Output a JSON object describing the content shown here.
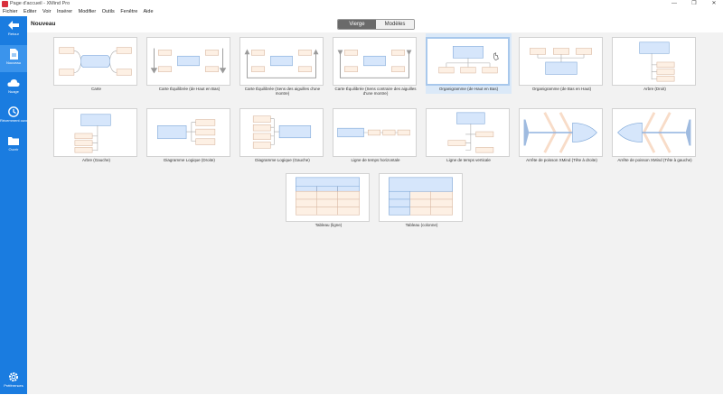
{
  "window": {
    "title": "Page d'accueil - XMind Pro",
    "min": "—",
    "max": "❐",
    "close": "✕"
  },
  "menu": [
    "Fichier",
    "Editer",
    "Voir",
    "Insérer",
    "Modifier",
    "Outils",
    "Fenêtre",
    "Aide"
  ],
  "sidebar": {
    "items": [
      {
        "label": "Retour",
        "icon": "back-arrow-icon"
      },
      {
        "label": "Nouveau",
        "icon": "new-document-icon"
      },
      {
        "label": "Nuage",
        "icon": "cloud-icon"
      },
      {
        "label": "Récemment ouvert",
        "icon": "clock-icon"
      },
      {
        "label": "Ouvrir",
        "icon": "folder-icon"
      }
    ],
    "bottom": {
      "label": "Préférences",
      "icon": "gear-icon"
    }
  },
  "header": {
    "title": "Nouveau"
  },
  "tabs": {
    "active": "Vierge",
    "inactive": "Modèles"
  },
  "colors": {
    "sidebar": "#1a7ce0",
    "blue_topic": "#d6e6fb",
    "blue_border": "#7ea7d8",
    "peach_topic": "#fdf0e4",
    "peach_border": "#d9b8a2"
  },
  "templates": [
    {
      "label": "Carte"
    },
    {
      "label": "Carte Équilibrée (de Haut en Bas)"
    },
    {
      "label": "Carte Équilibrée (Sens des aiguilles d'une montre)"
    },
    {
      "label": "Carte Équilibrée (Sens contraire des aiguilles d'une montre)"
    },
    {
      "label": "Organigramme (de Haut en Bas)"
    },
    {
      "label": "Organigramme (de Bas en Haut)"
    },
    {
      "label": "Arbre (Droit)"
    },
    {
      "label": "Arbre (Gauche)"
    },
    {
      "label": "Diagramme Logique (Droite)"
    },
    {
      "label": "Diagramme Logique (Gauche)"
    },
    {
      "label": "Ligne de temps horizontale"
    },
    {
      "label": "Ligne de temps verticale"
    },
    {
      "label": "Arrête de poisson XMind (Tête à droite)"
    },
    {
      "label": "Arrête de poisson XMind (Tête à gauche)"
    },
    {
      "label": "Tableau (ligne)"
    },
    {
      "label": "Tableau (colonne)"
    }
  ]
}
